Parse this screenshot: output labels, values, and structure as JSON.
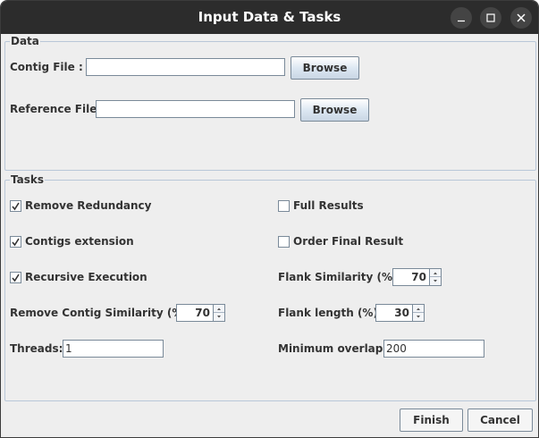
{
  "window": {
    "title": "Input Data & Tasks"
  },
  "data_group": {
    "legend": "Data",
    "contig_label": "Contig File  :",
    "contig_value": "",
    "contig_browse": "Browse",
    "reference_label": "Reference File:",
    "reference_value": "",
    "reference_browse": "Browse"
  },
  "tasks_group": {
    "legend": "Tasks",
    "remove_redundancy": {
      "label": "Remove Redundancy",
      "checked": true
    },
    "contigs_extension": {
      "label": "Contigs extension",
      "checked": true
    },
    "recursive_execution": {
      "label": "Recursive Execution",
      "checked": true
    },
    "full_results": {
      "label": "Full Results",
      "checked": false
    },
    "order_final_result": {
      "label": "Order Final Result",
      "checked": false
    },
    "remove_contig_similarity": {
      "label": "Remove Contig Similarity (%):",
      "value": "70"
    },
    "flank_similarity": {
      "label": "Flank Similarity (%):",
      "value": "70"
    },
    "flank_length": {
      "label": "Flank length (%):",
      "value": "30"
    },
    "threads": {
      "label": "Threads:",
      "value": "1"
    },
    "minimum_overlap": {
      "label": "Minimum overlap:",
      "value": "200"
    }
  },
  "footer": {
    "finish": "Finish",
    "cancel": "Cancel"
  }
}
